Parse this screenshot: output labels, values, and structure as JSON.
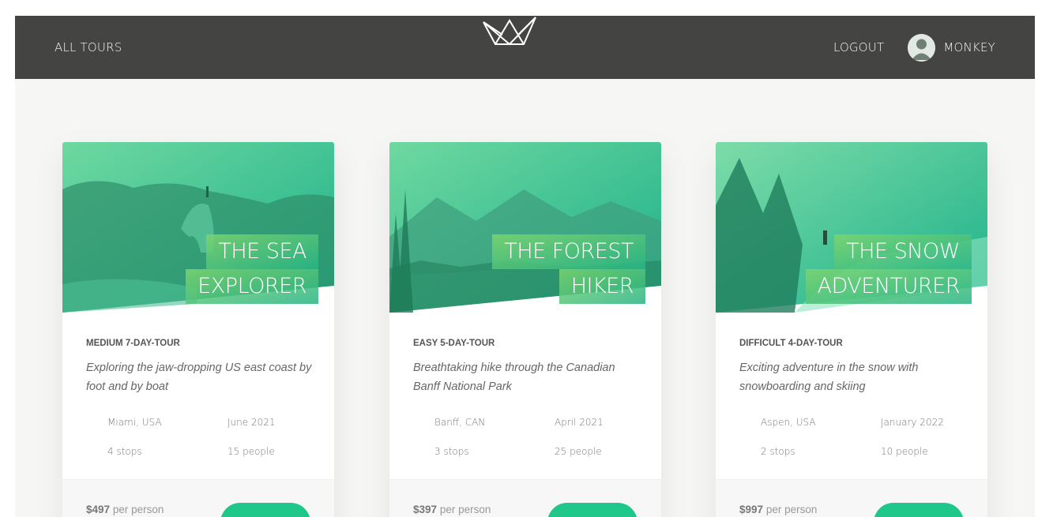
{
  "header": {
    "all_tours": "ALL TOURS",
    "logout": "LOGOUT",
    "username": "MONKEY"
  },
  "tours": [
    {
      "title_line1": "THE SEA",
      "title_line2": "EXPLORER",
      "difficulty": "MEDIUM 7-DAY-TOUR",
      "summary": "Exploring the jaw-dropping US east coast by foot and by boat",
      "location": "Miami, USA",
      "date": "June 2021",
      "stops": "4 stops",
      "people": "15 people",
      "price": "$497",
      "price_unit": "per person"
    },
    {
      "title_line1": "THE FOREST",
      "title_line2": "HIKER",
      "difficulty": "EASY 5-DAY-TOUR",
      "summary": "Breathtaking hike through the Canadian Banff National Park",
      "location": "Banff, CAN",
      "date": "April 2021",
      "stops": "3 stops",
      "people": "25 people",
      "price": "$397",
      "price_unit": "per person"
    },
    {
      "title_line1": "THE SNOW",
      "title_line2": "ADVENTURER",
      "difficulty": "DIFFICULT 4-DAY-TOUR",
      "summary": "Exciting adventure in the snow with snowboarding and skiing",
      "location": "Aspen, USA",
      "date": "January 2022",
      "stops": "2 stops",
      "people": "10 people",
      "price": "$997",
      "price_unit": "per person"
    }
  ],
  "colors": {
    "header_bg": "#444442",
    "accent": "#20c78a",
    "page_bg": "#f6f6f4"
  }
}
